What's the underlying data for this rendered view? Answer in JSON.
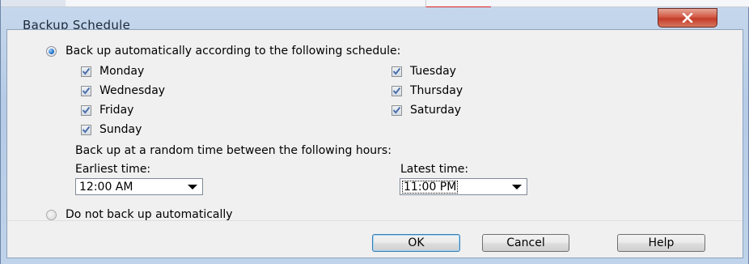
{
  "window": {
    "title": "Backup Schedule",
    "close_label": "×"
  },
  "schedule": {
    "auto_option_label": "Back up automatically according to the following schedule:",
    "auto_selected": true,
    "days": [
      {
        "label": "Monday",
        "checked": true
      },
      {
        "label": "Tuesday",
        "checked": true
      },
      {
        "label": "Wednesday",
        "checked": true
      },
      {
        "label": "Thursday",
        "checked": true
      },
      {
        "label": "Friday",
        "checked": true
      },
      {
        "label": "Saturday",
        "checked": true
      },
      {
        "label": "Sunday",
        "checked": true
      }
    ],
    "random_time_label": "Back up at a random time between the following hours:",
    "earliest_label": "Earliest time:",
    "earliest_value": "12:00 AM",
    "latest_label": "Latest time:",
    "latest_value": "11:00 PM",
    "manual_option_label": "Do not back up automatically"
  },
  "buttons": {
    "ok": "OK",
    "cancel": "Cancel",
    "help": "Help"
  },
  "colors": {
    "frame": "#b5cbe6",
    "close": "#c33c2a",
    "client": "#f0f0f0",
    "radio_selected": "#1f6fc4",
    "checkbox_mark": "#4a6ea9"
  }
}
